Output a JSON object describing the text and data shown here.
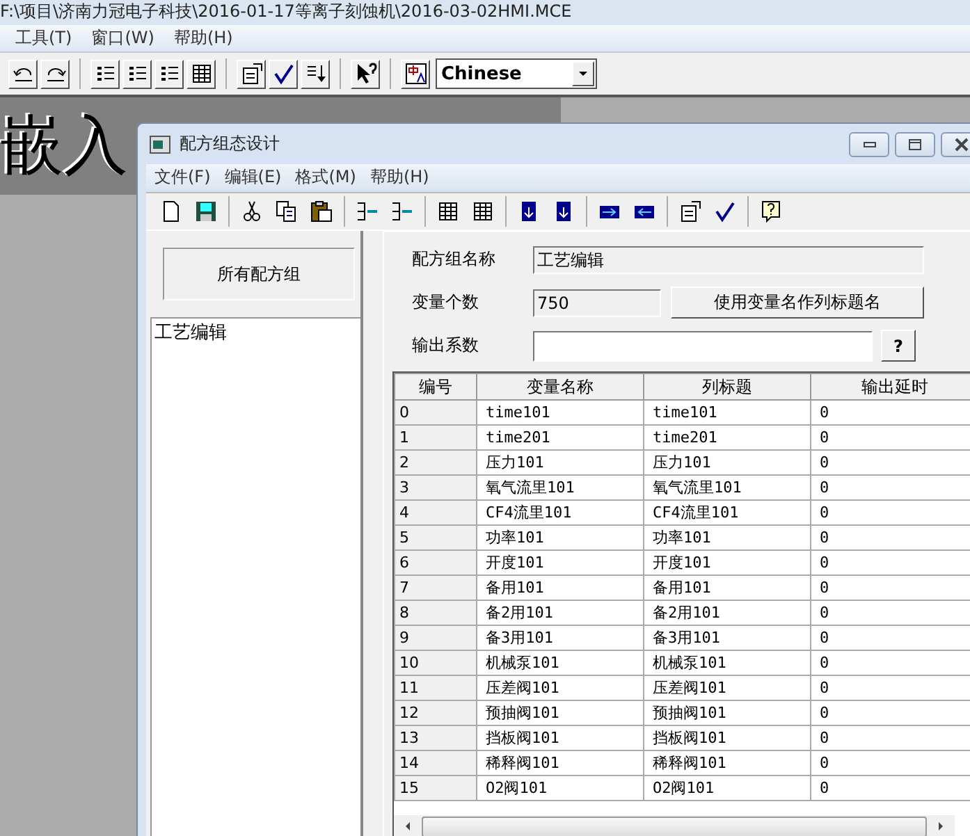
{
  "app": {
    "title": "F:\\项目\\济南力冠电子科技\\2016-01-17等离子刻蚀机\\2016-03-02HMI.MCE",
    "menu": [
      "工具(T)",
      "窗口(W)",
      "帮助(H)"
    ],
    "language": "Chinese",
    "banner": "嵌入"
  },
  "dialog": {
    "title": "配方组态设计",
    "menu": [
      "文件(F)",
      "编辑(E)",
      "格式(M)",
      "帮助(H)"
    ],
    "group_button": "所有配方组",
    "groups": [
      "工艺编辑"
    ],
    "fields": [
      {
        "label": "配方组名称",
        "value": "工艺编辑",
        "kind": "readonly"
      },
      {
        "label": "变量个数",
        "value": "750",
        "kind": "short"
      },
      {
        "label": "输出系数",
        "kind": "input"
      }
    ],
    "name_button": "使用变量名作列标题名",
    "help_button": "?",
    "table": {
      "columns": [
        "编号",
        "变量名称",
        "列标题",
        "输出延时"
      ],
      "rows": [
        [
          "0",
          "time101",
          "time101",
          "0"
        ],
        [
          "1",
          "time201",
          "time201",
          "0"
        ],
        [
          "2",
          "压力101",
          "压力101",
          "0"
        ],
        [
          "3",
          "氧气流里101",
          "氧气流里101",
          "0"
        ],
        [
          "4",
          "CF4流里101",
          "CF4流里101",
          "0"
        ],
        [
          "5",
          "功率101",
          "功率101",
          "0"
        ],
        [
          "6",
          "开度101",
          "开度101",
          "0"
        ],
        [
          "7",
          "备用101",
          "备用101",
          "0"
        ],
        [
          "8",
          "备2用101",
          "备2用101",
          "0"
        ],
        [
          "9",
          "备3用101",
          "备3用101",
          "0"
        ],
        [
          "10",
          "机械泵101",
          "机械泵101",
          "0"
        ],
        [
          "11",
          "压差阀101",
          "压差阀101",
          "0"
        ],
        [
          "12",
          "预抽阀101",
          "预抽阀101",
          "0"
        ],
        [
          "13",
          "挡板阀101",
          "挡板阀101",
          "0"
        ],
        [
          "14",
          "稀释阀101",
          "稀释阀101",
          "0"
        ],
        [
          "15",
          "O2阀101",
          "O2阀101",
          "0"
        ]
      ]
    }
  }
}
